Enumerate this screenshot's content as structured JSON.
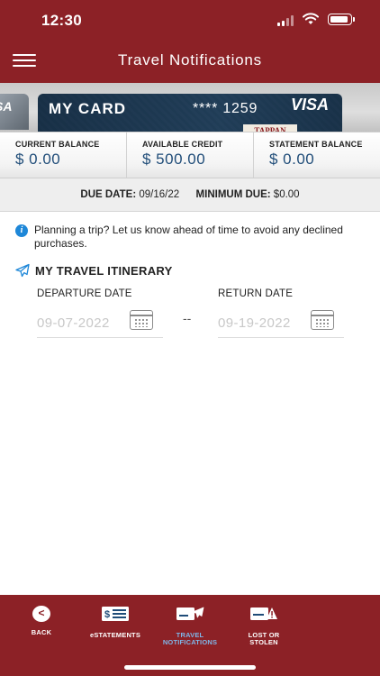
{
  "status_bar": {
    "time": "12:30"
  },
  "header": {
    "title": "Travel Notifications"
  },
  "card": {
    "prev_card_label": "SA",
    "name": "MY CARD",
    "number": "**** 1259",
    "network": "VISA",
    "bank_logo": "TAPPAN"
  },
  "balances": {
    "current": {
      "label": "CURRENT BALANCE",
      "value": "$ 0.00"
    },
    "available": {
      "label": "AVAILABLE CREDIT",
      "value": "$ 500.00"
    },
    "statement": {
      "label": "STATEMENT BALANCE",
      "value": "$ 0.00"
    }
  },
  "due": {
    "due_date_label": "DUE DATE:",
    "due_date_value": "09/16/22",
    "minimum_due_label": "MINIMUM DUE:",
    "minimum_due_value": "$0.00"
  },
  "info": {
    "text": "Planning a trip? Let us know ahead of time to avoid any declined purchases."
  },
  "itinerary": {
    "title": "MY TRAVEL ITINERARY",
    "departure_label": "DEPARTURE DATE",
    "departure_placeholder": "09-07-2022",
    "separator": "--",
    "return_label": "RETURN DATE",
    "return_placeholder": "09-19-2022"
  },
  "nav": {
    "items": [
      {
        "label": "BACK",
        "icon": "back-icon"
      },
      {
        "label": "eSTATEMENTS",
        "icon": "statement-icon"
      },
      {
        "label": "TRAVEL\nNOTIFICATIONS",
        "label_line1": "TRAVEL",
        "label_line2": "NOTIFICATIONS",
        "icon": "travel-card-icon",
        "active": true
      },
      {
        "label_line1": "LOST OR",
        "label_line2": "STOLEN",
        "icon": "lost-stolen-icon"
      }
    ]
  },
  "colors": {
    "brand": "#8c2126",
    "value_blue": "#1f4c78",
    "active_nav": "#7fb6e8",
    "info_blue": "#1e87d8"
  }
}
